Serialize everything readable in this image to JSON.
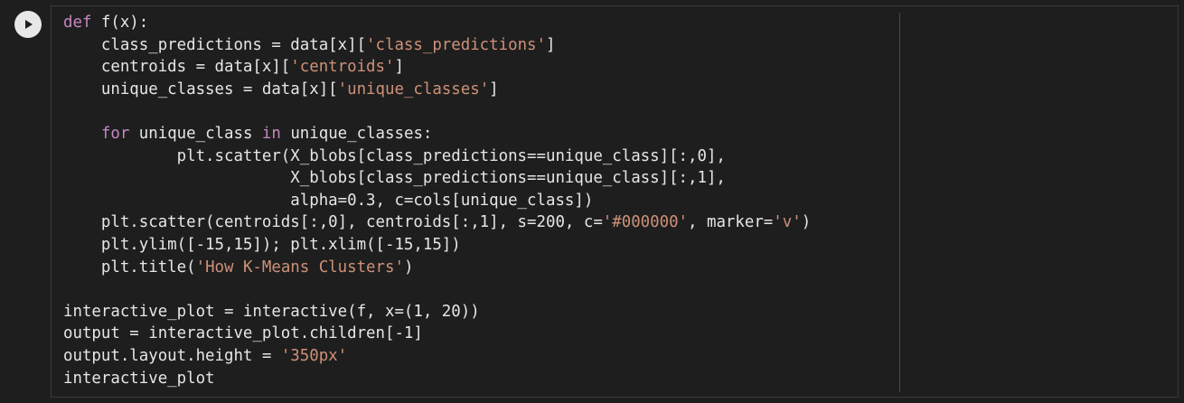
{
  "cell": {
    "run_button": "run-cell",
    "lines": [
      [
        {
          "t": "def",
          "c": "kw"
        },
        {
          "t": " f(x):",
          "c": "id"
        }
      ],
      [
        {
          "t": "    class_predictions = data[x][",
          "c": "id"
        },
        {
          "t": "'class_predictions'",
          "c": "str"
        },
        {
          "t": "]",
          "c": "id"
        }
      ],
      [
        {
          "t": "    centroids = data[x][",
          "c": "id"
        },
        {
          "t": "'centroids'",
          "c": "str"
        },
        {
          "t": "]",
          "c": "id"
        }
      ],
      [
        {
          "t": "    unique_classes = data[x][",
          "c": "id"
        },
        {
          "t": "'unique_classes'",
          "c": "str"
        },
        {
          "t": "]",
          "c": "id"
        }
      ],
      [
        {
          "t": "",
          "c": "id"
        }
      ],
      [
        {
          "t": "    ",
          "c": "id"
        },
        {
          "t": "for",
          "c": "kw"
        },
        {
          "t": " unique_class ",
          "c": "id"
        },
        {
          "t": "in",
          "c": "kw"
        },
        {
          "t": " unique_classes:",
          "c": "id"
        }
      ],
      [
        {
          "t": "            plt.scatter(X_blobs[class_predictions==unique_class][:,0],",
          "c": "id"
        }
      ],
      [
        {
          "t": "                        X_blobs[class_predictions==unique_class][:,1],",
          "c": "id"
        }
      ],
      [
        {
          "t": "                        alpha=0.3, c=cols[unique_class])",
          "c": "id"
        }
      ],
      [
        {
          "t": "    plt.scatter(centroids[:,0], centroids[:,1], s=200, c=",
          "c": "id"
        },
        {
          "t": "'#000000'",
          "c": "str"
        },
        {
          "t": ", marker=",
          "c": "id"
        },
        {
          "t": "'v'",
          "c": "str"
        },
        {
          "t": ")",
          "c": "id"
        }
      ],
      [
        {
          "t": "    plt.ylim([-15,15]); plt.xlim([-15,15])",
          "c": "id"
        }
      ],
      [
        {
          "t": "    plt.title(",
          "c": "id"
        },
        {
          "t": "'How K-Means Clusters'",
          "c": "str"
        },
        {
          "t": ")",
          "c": "id"
        }
      ],
      [
        {
          "t": "",
          "c": "id"
        }
      ],
      [
        {
          "t": "interactive_plot = interactive(f, x=(1, 20))",
          "c": "id"
        }
      ],
      [
        {
          "t": "output = interactive_plot.children[-1]",
          "c": "id"
        }
      ],
      [
        {
          "t": "output.layout.height = ",
          "c": "id"
        },
        {
          "t": "'350px'",
          "c": "str"
        }
      ],
      [
        {
          "t": "interactive_plot",
          "c": "id"
        }
      ]
    ]
  },
  "colors": {
    "background": "#1e1e1e",
    "keyword": "#c586c0",
    "string": "#ce9178",
    "text": "#e6e6e6"
  }
}
